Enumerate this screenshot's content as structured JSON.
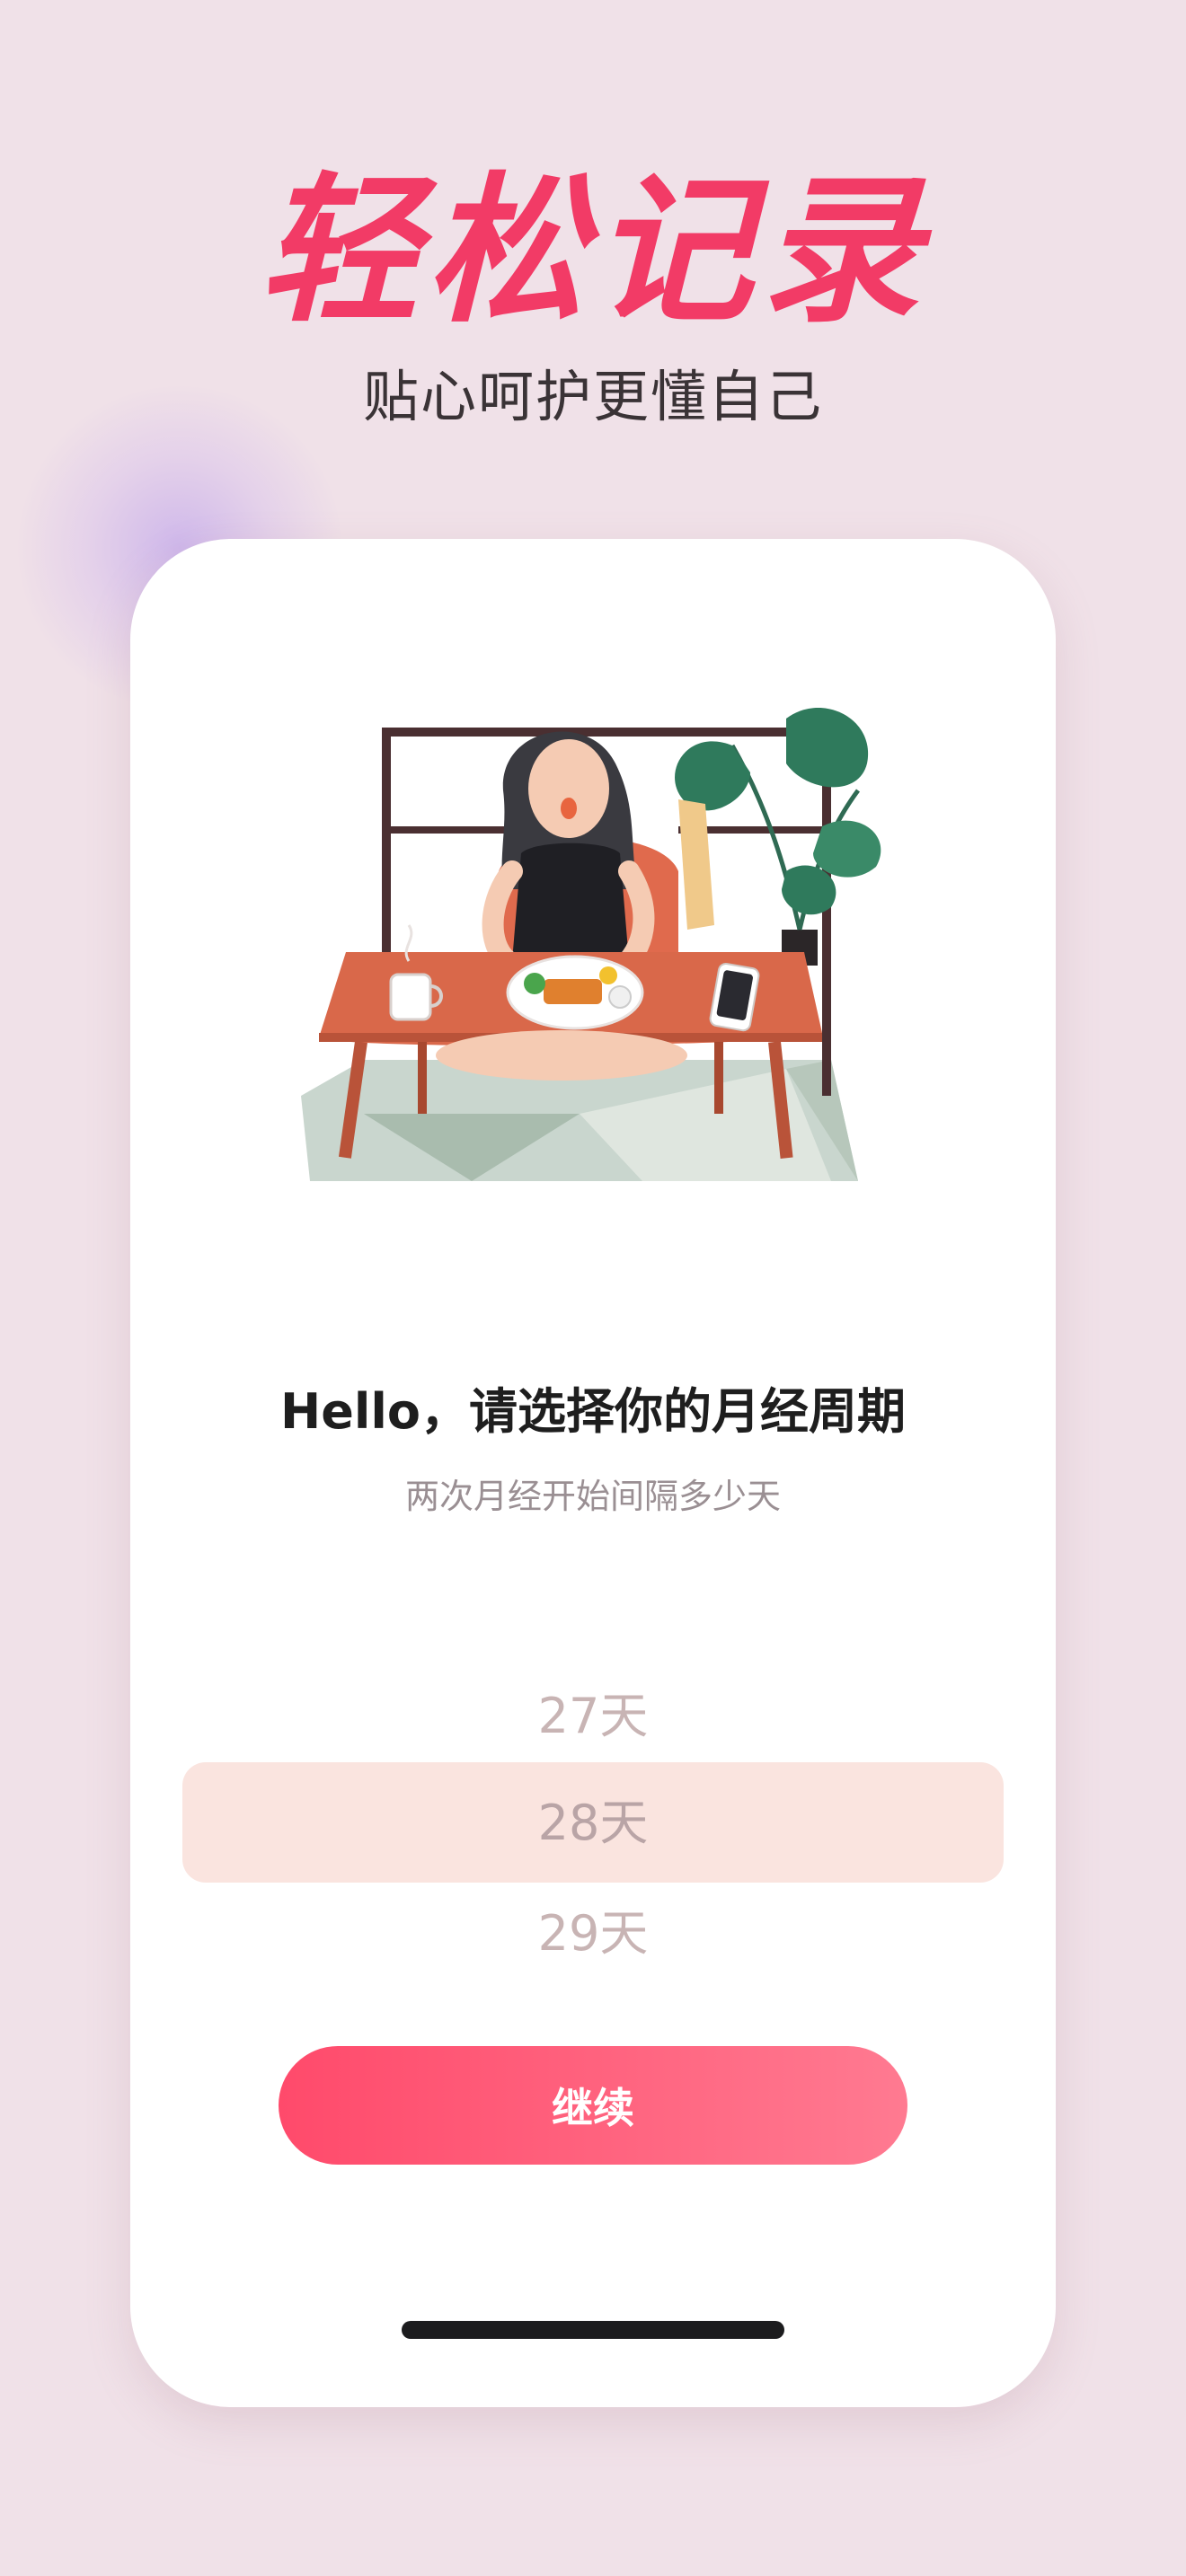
{
  "hero": {
    "title": "轻松记录",
    "subtitle": "贴心呵护更懂自己"
  },
  "card": {
    "title": "Hello，请选择你的月经周期",
    "subtitle": "两次月经开始间隔多少天"
  },
  "picker": {
    "options": [
      "27天",
      "28天",
      "29天"
    ],
    "selected_index": 1
  },
  "continue_button": {
    "label": "继续"
  },
  "colors": {
    "accent": "#f23b66",
    "button_start": "#ff4a6b",
    "button_end": "#ff7a91",
    "picker_highlight": "#fae4df",
    "background": "#f0e1e8"
  },
  "icons": {
    "illustration": "woman-eating-at-table-illustration"
  }
}
